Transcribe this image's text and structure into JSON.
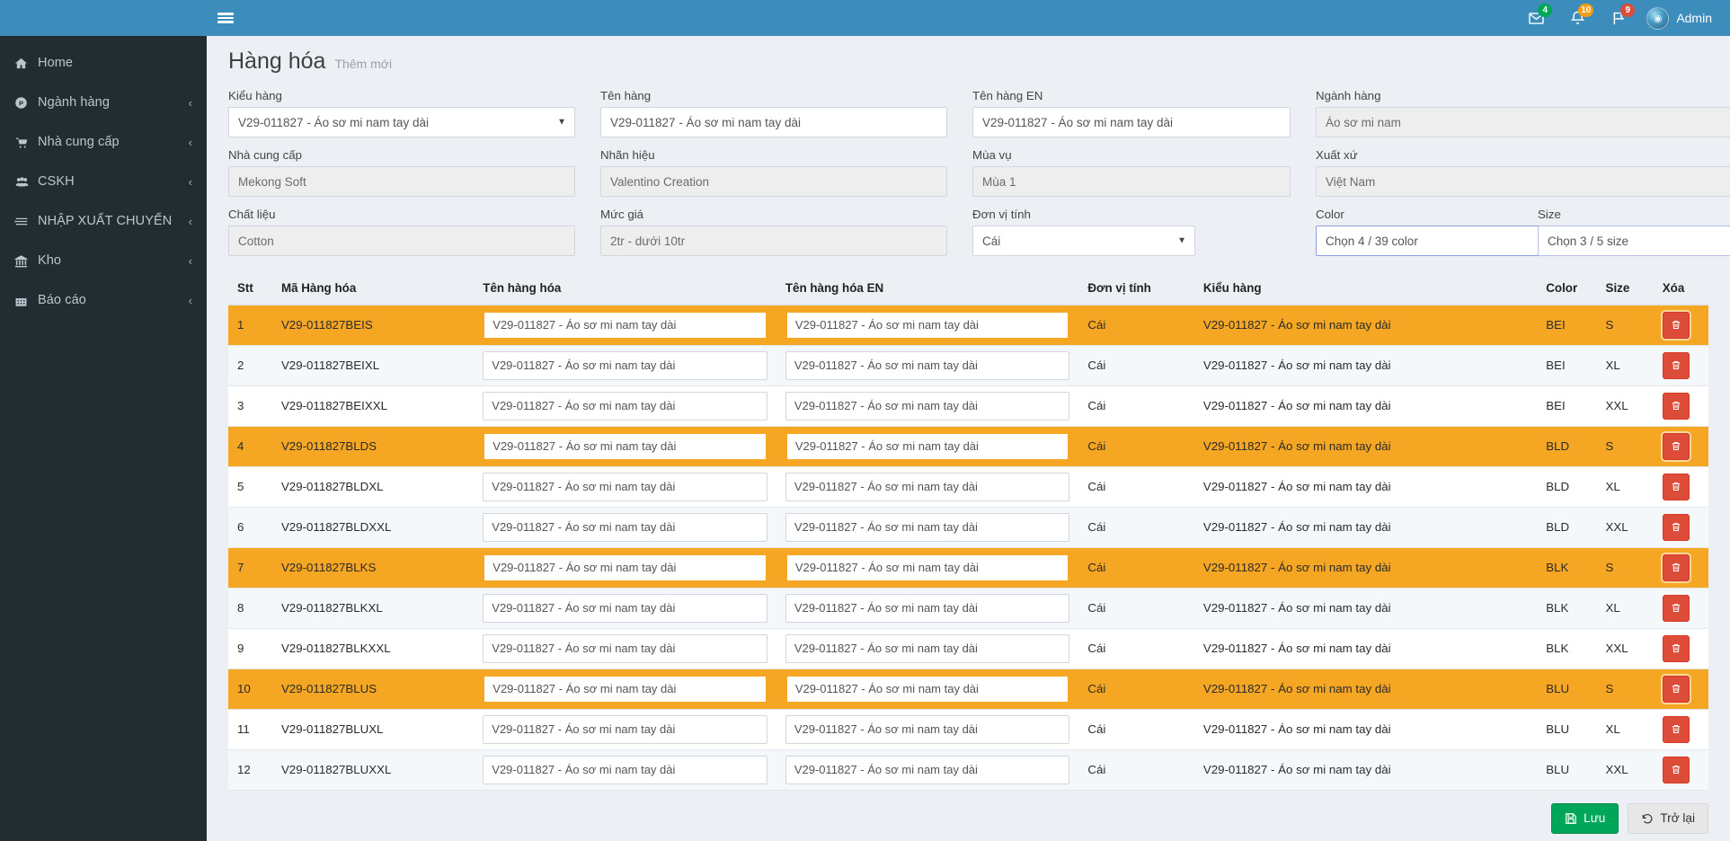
{
  "sidebar": {
    "items": [
      {
        "label": "Home",
        "icon": "home-icon",
        "arrow": ""
      },
      {
        "label": "Ngành hàng",
        "icon": "category-icon",
        "arrow": "‹"
      },
      {
        "label": "Nhà cung cấp",
        "icon": "supplier-icon",
        "arrow": "‹"
      },
      {
        "label": "CSKH",
        "icon": "customers-icon",
        "arrow": "‹"
      },
      {
        "label": "NHẬP XUẤT CHUYỂN",
        "icon": "transfer-icon",
        "arrow": "‹"
      },
      {
        "label": "Kho",
        "icon": "warehouse-icon",
        "arrow": "‹"
      },
      {
        "label": "Báo cáo",
        "icon": "report-icon",
        "arrow": "‹"
      }
    ]
  },
  "navbar": {
    "menu_toggle": "hamburger-icon",
    "messages_badge": "4",
    "notifications_badge": "10",
    "tasks_badge": "9",
    "user_name": "Admin",
    "accent_color": "#3c8dbc"
  },
  "page": {
    "title": "Hàng hóa",
    "subtitle": "Thêm mới"
  },
  "form": {
    "kieu_hang": {
      "label": "Kiểu hàng",
      "value": "V29-011827 - Áo sơ mi nam tay dài"
    },
    "ten_hang": {
      "label": "Tên hàng",
      "value": "V29-011827 - Áo sơ mi nam tay dài"
    },
    "ten_hang_en": {
      "label": "Tên hàng EN",
      "value": "V29-011827 - Áo sơ mi nam tay dài"
    },
    "nganh_hang": {
      "label": "Ngành hàng",
      "value": "Áo sơ mi nam"
    },
    "nha_cung_cap": {
      "label": "Nhà cung cấp",
      "value": "Mekong Soft"
    },
    "nhan_hieu": {
      "label": "Nhãn hiệu",
      "value": "Valentino Creation"
    },
    "mua_vu": {
      "label": "Mùa vụ",
      "value": "Mùa 1"
    },
    "xuat_xu": {
      "label": "Xuất xứ",
      "value": "Việt Nam"
    },
    "chat_lieu": {
      "label": "Chất liệu",
      "value": "Cotton"
    },
    "muc_gia": {
      "label": "Mức giá",
      "value": "2tr - dưới 10tr"
    },
    "don_vi_tinh": {
      "label": "Đơn vị tính",
      "value": "Cái"
    },
    "color": {
      "label": "Color",
      "value": "Chọn 4 / 39 color"
    },
    "size": {
      "label": "Size",
      "value": "Chọn 3 / 5 size"
    }
  },
  "table": {
    "columns": [
      "Stt",
      "Mã Hàng hóa",
      "Tên hàng hóa",
      "Tên hàng hóa EN",
      "Đơn vị tính",
      "Kiểu hàng",
      "Color",
      "Size",
      "Xóa"
    ],
    "rows": [
      {
        "stt": "1",
        "ma": "V29-011827BEIS",
        "ten": "V29-011827 - Áo sơ mi nam tay dài",
        "ten_en": "V29-011827 - Áo sơ mi nam tay dài",
        "dvt": "Cái",
        "kieu": "V29-011827 - Áo sơ mi nam tay dài",
        "color": "BEI",
        "size": "S",
        "highlight": true
      },
      {
        "stt": "2",
        "ma": "V29-011827BEIXL",
        "ten": "V29-011827 - Áo sơ mi nam tay dài",
        "ten_en": "V29-011827 - Áo sơ mi nam tay dài",
        "dvt": "Cái",
        "kieu": "V29-011827 - Áo sơ mi nam tay dài",
        "color": "BEI",
        "size": "XL",
        "highlight": false
      },
      {
        "stt": "3",
        "ma": "V29-011827BEIXXL",
        "ten": "V29-011827 - Áo sơ mi nam tay dài",
        "ten_en": "V29-011827 - Áo sơ mi nam tay dài",
        "dvt": "Cái",
        "kieu": "V29-011827 - Áo sơ mi nam tay dài",
        "color": "BEI",
        "size": "XXL",
        "highlight": false
      },
      {
        "stt": "4",
        "ma": "V29-011827BLDS",
        "ten": "V29-011827 - Áo sơ mi nam tay dài",
        "ten_en": "V29-011827 - Áo sơ mi nam tay dài",
        "dvt": "Cái",
        "kieu": "V29-011827 - Áo sơ mi nam tay dài",
        "color": "BLD",
        "size": "S",
        "highlight": true
      },
      {
        "stt": "5",
        "ma": "V29-011827BLDXL",
        "ten": "V29-011827 - Áo sơ mi nam tay dài",
        "ten_en": "V29-011827 - Áo sơ mi nam tay dài",
        "dvt": "Cái",
        "kieu": "V29-011827 - Áo sơ mi nam tay dài",
        "color": "BLD",
        "size": "XL",
        "highlight": false
      },
      {
        "stt": "6",
        "ma": "V29-011827BLDXXL",
        "ten": "V29-011827 - Áo sơ mi nam tay dài",
        "ten_en": "V29-011827 - Áo sơ mi nam tay dài",
        "dvt": "Cái",
        "kieu": "V29-011827 - Áo sơ mi nam tay dài",
        "color": "BLD",
        "size": "XXL",
        "highlight": false
      },
      {
        "stt": "7",
        "ma": "V29-011827BLKS",
        "ten": "V29-011827 - Áo sơ mi nam tay dài",
        "ten_en": "V29-011827 - Áo sơ mi nam tay dài",
        "dvt": "Cái",
        "kieu": "V29-011827 - Áo sơ mi nam tay dài",
        "color": "BLK",
        "size": "S",
        "highlight": true
      },
      {
        "stt": "8",
        "ma": "V29-011827BLKXL",
        "ten": "V29-011827 - Áo sơ mi nam tay dài",
        "ten_en": "V29-011827 - Áo sơ mi nam tay dài",
        "dvt": "Cái",
        "kieu": "V29-011827 - Áo sơ mi nam tay dài",
        "color": "BLK",
        "size": "XL",
        "highlight": false
      },
      {
        "stt": "9",
        "ma": "V29-011827BLKXXL",
        "ten": "V29-011827 - Áo sơ mi nam tay dài",
        "ten_en": "V29-011827 - Áo sơ mi nam tay dài",
        "dvt": "Cái",
        "kieu": "V29-011827 - Áo sơ mi nam tay dài",
        "color": "BLK",
        "size": "XXL",
        "highlight": false
      },
      {
        "stt": "10",
        "ma": "V29-011827BLUS",
        "ten": "V29-011827 - Áo sơ mi nam tay dài",
        "ten_en": "V29-011827 - Áo sơ mi nam tay dài",
        "dvt": "Cái",
        "kieu": "V29-011827 - Áo sơ mi nam tay dài",
        "color": "BLU",
        "size": "S",
        "highlight": true
      },
      {
        "stt": "11",
        "ma": "V29-011827BLUXL",
        "ten": "V29-011827 - Áo sơ mi nam tay dài",
        "ten_en": "V29-011827 - Áo sơ mi nam tay dài",
        "dvt": "Cái",
        "kieu": "V29-011827 - Áo sơ mi nam tay dài",
        "color": "BLU",
        "size": "XL",
        "highlight": false
      },
      {
        "stt": "12",
        "ma": "V29-011827BLUXXL",
        "ten": "V29-011827 - Áo sơ mi nam tay dài",
        "ten_en": "V29-011827 - Áo sơ mi nam tay dài",
        "dvt": "Cái",
        "kieu": "V29-011827 - Áo sơ mi nam tay dài",
        "color": "BLU",
        "size": "XXL",
        "highlight": false
      }
    ],
    "delete_icon": "trash-icon",
    "highlight_color": "#f5a623"
  },
  "actions": {
    "save_label": "Lưu",
    "save_icon": "floppy-icon",
    "save_color": "#00a65a",
    "back_label": "Trở lại",
    "back_icon": "undo-icon"
  }
}
